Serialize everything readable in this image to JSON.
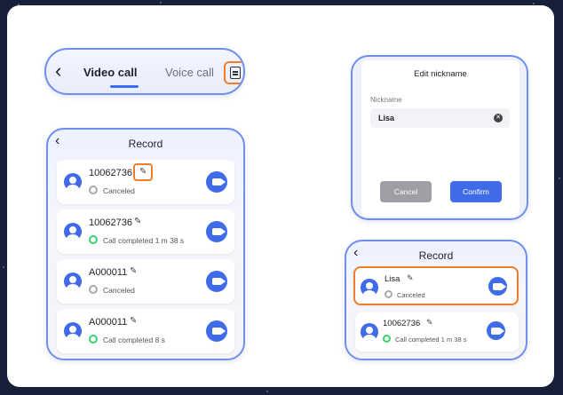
{
  "tabs_bar": {
    "active_tab": "Video call",
    "inactive_tab": "Voice call",
    "back_glyph": "‹",
    "record_icon": "document-list-icon"
  },
  "record_panel_left": {
    "title": "Record",
    "items": [
      {
        "name": "10062736",
        "status": "Canceled",
        "status_type": "canceled"
      },
      {
        "name": "10062736",
        "status": "Call completed 1 m 38 s",
        "status_type": "completed"
      },
      {
        "name": "A000011",
        "status": "Canceled",
        "status_type": "canceled"
      },
      {
        "name": "A000011",
        "status": "Call completed 8 s",
        "status_type": "completed"
      }
    ]
  },
  "edit_dialog": {
    "title": "Edit nickname",
    "label": "Nickname",
    "value": "Lisa",
    "cancel_label": "Cancel",
    "confirm_label": "Confirm"
  },
  "record_panel_right": {
    "title": "Record",
    "items": [
      {
        "name": "Lisa",
        "status": "Canceled",
        "status_type": "canceled"
      },
      {
        "name": "10062736",
        "status": "Call completed 1 m 38 s",
        "status_type": "completed"
      }
    ]
  },
  "colors": {
    "accent": "#3f6be8",
    "highlight": "#f07d2a",
    "panel_border": "#6f8ef0",
    "completed": "#3bcf6a"
  }
}
